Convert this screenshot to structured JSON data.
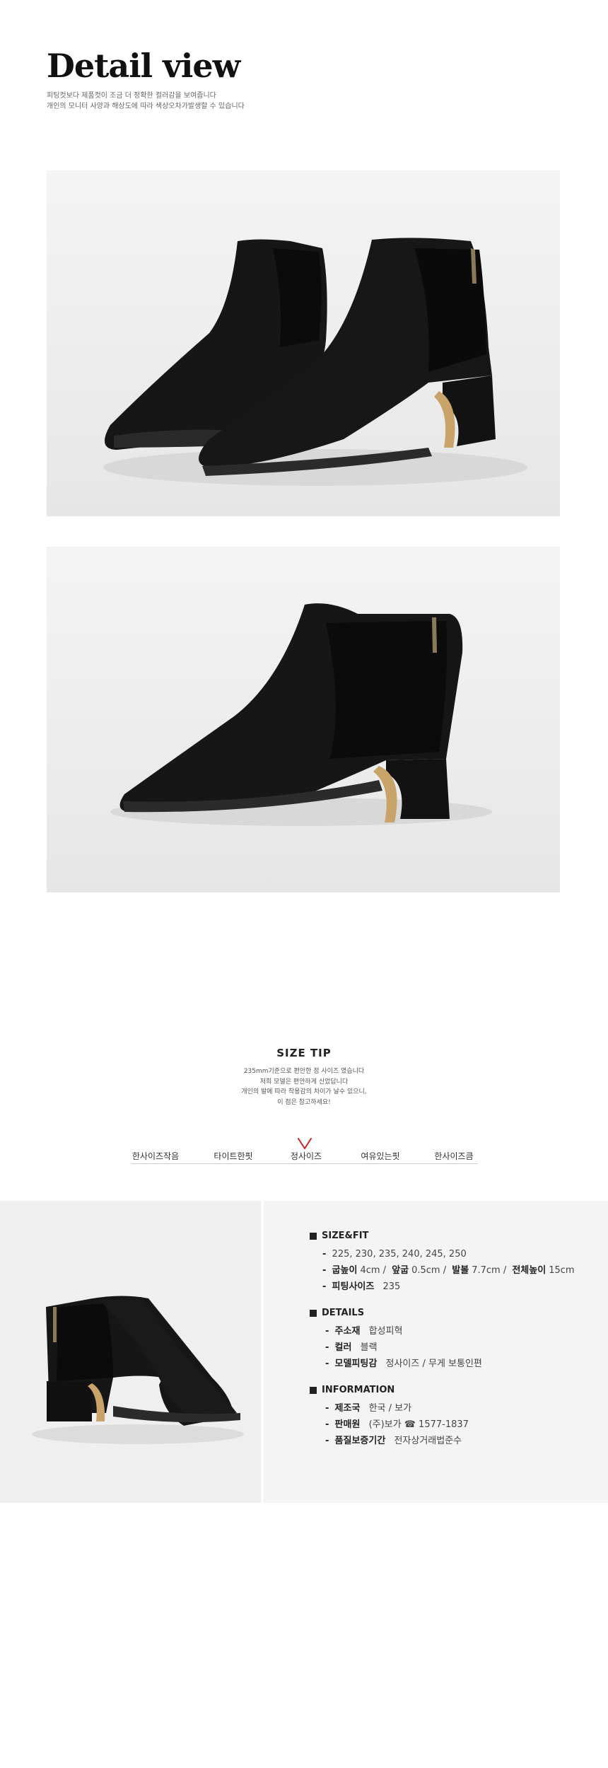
{
  "header": {
    "title": "Detail view",
    "subtitle_lines": [
      "피팅컷보다 제품컷이 조금 더 정확한 컬러감을 보여줍니다",
      "개인의 모니터 사양과 해상도에 따라 색상오차가발생할 수 있습니다"
    ]
  },
  "size_tip": {
    "title": "SIZE TIP",
    "lines": [
      "235mm기준으로 편안한 정 사이즈 였습니다",
      "저희 모델은 편안하게 신었답니다",
      "개인의 발에 따라 착용감의 차이가 날수 있으니,",
      "이 점은 참고하세요!"
    ],
    "options": [
      "한사이즈작음",
      "타이트한핏",
      "정사이즈",
      "여유있는핏",
      "한사이즈큼"
    ],
    "selected": "정사이즈",
    "marker_color": "#cc2222"
  },
  "info": {
    "size_fit": {
      "heading": "SIZE&FIT",
      "sizes": "225, 230, 235, 240, 245, 250",
      "heel_label": "굽높이",
      "heel_value": "4cm",
      "front_label": "앞굽",
      "front_value": "0.5cm",
      "foot_label": "발볼",
      "foot_value": "7.7cm",
      "total_label": "전체높이",
      "total_value": "15cm",
      "fitting_label": "피팅사이즈",
      "fitting_value": "235"
    },
    "details": {
      "heading": "DETAILS",
      "material_label": "주소재",
      "material_value": "합성피혁",
      "color_label": "컬러",
      "color_value": "블랙",
      "model_label": "모델피팅감",
      "model_value": "정사이즈 / 무게 보통인편"
    },
    "information": {
      "heading": "INFORMATION",
      "origin_label": "제조국",
      "origin_value": "한국 / 보가",
      "seller_label": "판매원",
      "seller_value": "(주)보가 ☎ 1577-1837",
      "warranty_label": "품질보증기간",
      "warranty_value": "전자상거래법준수"
    }
  },
  "colors": {
    "shoe": "#141414",
    "gold": "#c9a46a",
    "background": "#ececec"
  }
}
